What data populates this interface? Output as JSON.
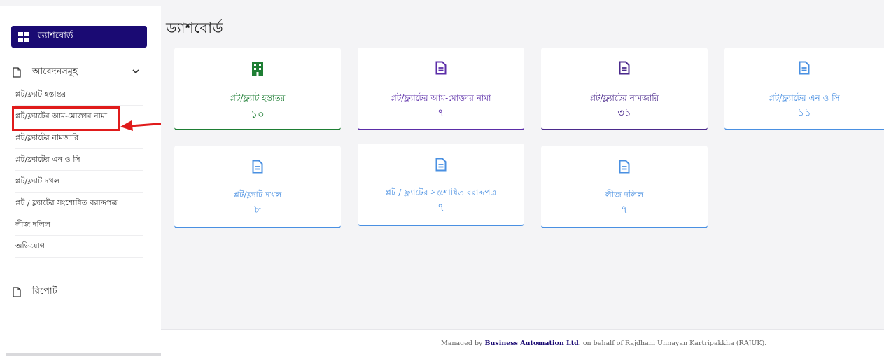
{
  "sidebar": {
    "dashboard_label": "ড্যাশবোর্ড",
    "applications_label": "আবেদনসমূহ",
    "report_label": "রিপোর্ট",
    "items": [
      "প্লট/ফ্ল্যাট হস্তান্তর",
      "প্লট/ফ্ল্যাটের আম-মোক্তার নামা",
      "প্লট/ফ্ল্যাটের নামজারি",
      "প্লট/ফ্ল্যাটের এন ও সি",
      "প্লট/ফ্ল্যাট দখল",
      "প্লট / ফ্ল্যাটের সংশোধিত বরাদ্দপত্র",
      "লীজ দলিল",
      "অভিযোগ"
    ]
  },
  "main": {
    "title": "ড্যাশবোর্ড",
    "cards": [
      {
        "label": "প্লট/ফ্ল্যাট হস্তান্তর",
        "count": "১০",
        "icon": "building-icon",
        "color": "#1e7e34"
      },
      {
        "label": "প্লট/ফ্ল্যাটের আম-মোক্তার নামা",
        "count": "৭",
        "icon": "document-icon",
        "color": "#5b2da8"
      },
      {
        "label": "প্লট/ফ্ল্যাটের নামজারি",
        "count": "৩১",
        "icon": "document-icon",
        "color": "#4b2a8c"
      },
      {
        "label": "প্লট/ফ্ল্যাটের এন ও সি",
        "count": "১১",
        "icon": "document-icon",
        "color": "#4a90e2"
      },
      {
        "label": "প্লট/ফ্ল্যাট দখল",
        "count": "৮",
        "icon": "document-icon",
        "color": "#4a90e2"
      },
      {
        "label": "প্লট / ফ্ল্যাটের সংশোধিত বরাদ্দপত্র",
        "count": "৭",
        "icon": "document-icon",
        "color": "#4a90e2"
      },
      {
        "label": "লীজ দলিল",
        "count": "৭",
        "icon": "document-icon",
        "color": "#4a90e2"
      }
    ]
  },
  "footer": {
    "prefix": "Managed by ",
    "company": "Business Automation Ltd",
    "suffix": ". on behalf of Rajdhani Unnayan Kartripakkha (RAJUK)."
  },
  "colors": {
    "sidebar_active": "#1a0a73",
    "highlight": "#e01b1b",
    "green": "#1e7e34",
    "purple": "#5b2da8",
    "blue": "#4a90e2"
  }
}
